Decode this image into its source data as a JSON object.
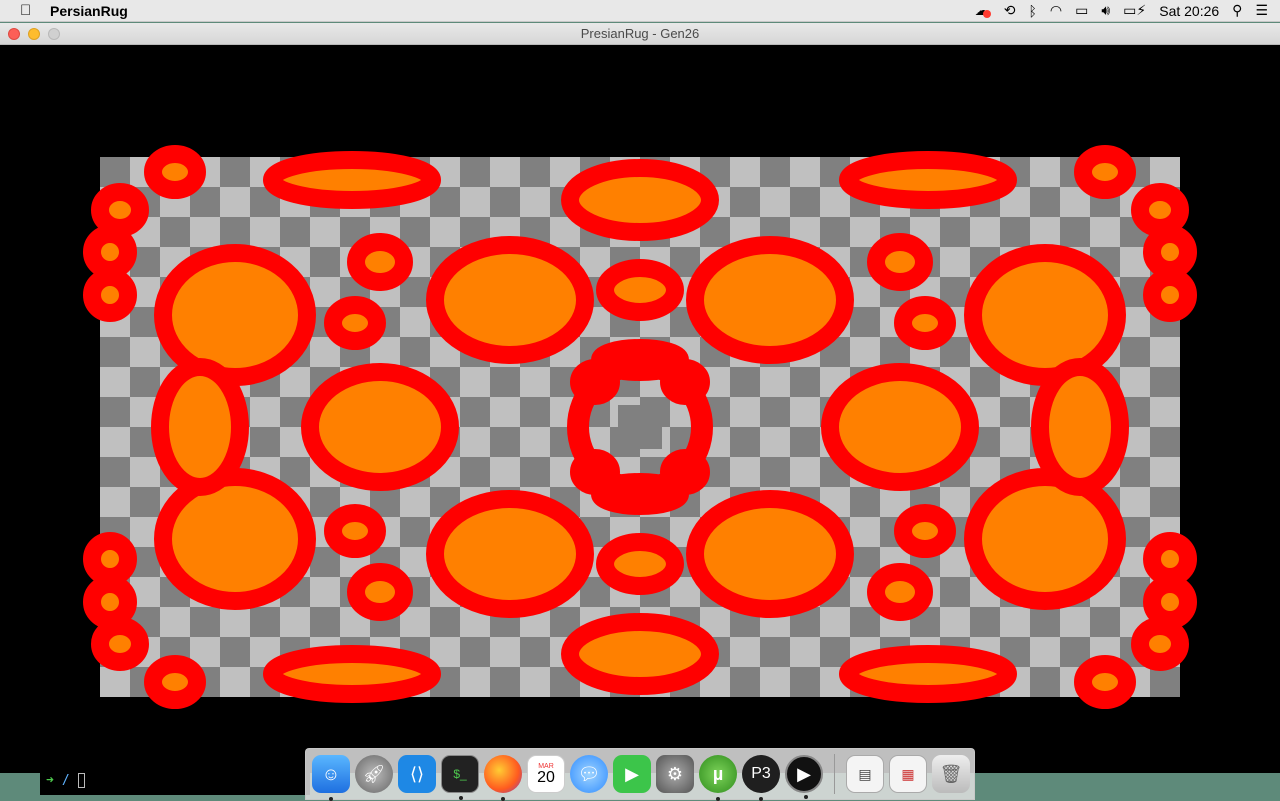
{
  "menubar": {
    "app_name": "PersianRug",
    "clock": "Sat 20:26",
    "status_icons": [
      "creative-cloud-icon",
      "time-machine-icon",
      "bluetooth-icon",
      "wifi-icon",
      "airplay-icon",
      "volume-icon",
      "battery-charging-icon"
    ],
    "right_icons": [
      "spotlight-search-icon",
      "notification-center-icon"
    ]
  },
  "window": {
    "title": "PresianRug - Gen26"
  },
  "rug": {
    "colors": {
      "background": "#000000",
      "light": "#c0c0c0",
      "dark": "#808080",
      "fill": "#ff8000",
      "outline": "#ff0000"
    }
  },
  "terminal": {
    "prompt_arrow": "➜",
    "path": "/"
  },
  "dock": {
    "items": [
      {
        "name": "finder-icon",
        "running": true
      },
      {
        "name": "launchpad-icon",
        "running": false
      },
      {
        "name": "vscode-icon",
        "running": false
      },
      {
        "name": "terminal-icon",
        "running": true
      },
      {
        "name": "firefox-icon",
        "running": true
      },
      {
        "name": "calendar-icon",
        "running": false,
        "month": "MAR",
        "day": "20"
      },
      {
        "name": "messages-icon",
        "running": false
      },
      {
        "name": "facetime-icon",
        "running": false
      },
      {
        "name": "system-preferences-icon",
        "running": false
      },
      {
        "name": "utorrent-icon",
        "running": true
      },
      {
        "name": "processing-icon",
        "running": true
      },
      {
        "name": "quicktime-icon",
        "running": true
      }
    ],
    "trailing": [
      {
        "name": "document-stack-icon"
      },
      {
        "name": "downloads-stack-icon"
      },
      {
        "name": "trash-icon"
      }
    ]
  }
}
